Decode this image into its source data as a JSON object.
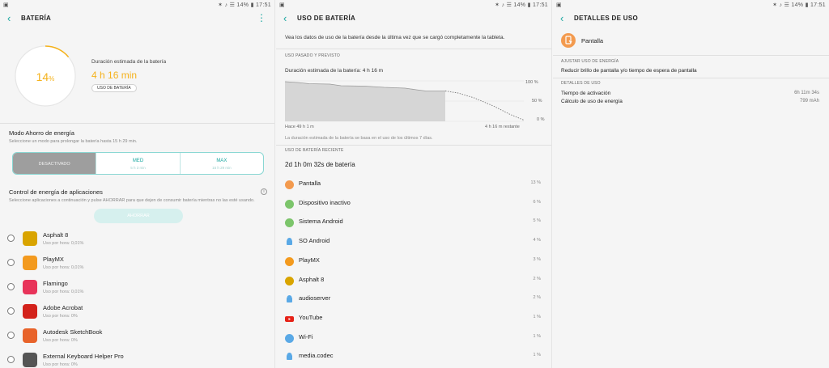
{
  "status": {
    "left_icon": "image-icon",
    "right_text": "✶ ♪ ☰ 14% ▮ 17:51"
  },
  "panel1": {
    "title": "BATERÍA",
    "battery_pct": "14",
    "battery_unit": "%",
    "battery_fraction": 0.14,
    "est_label": "Duración estimada de la batería",
    "est_time": "4 h 16 min",
    "uso_button": "USO DE BATERÍA",
    "modo_title": "Modo Ahorro de energía",
    "modo_sub": "Seleccione un modo para prolongar la batería hasta 15 h 29 min.",
    "modes": [
      {
        "label": "DESACTIVADO",
        "sub": ""
      },
      {
        "label": "MED",
        "sub": "5 h 3 min"
      },
      {
        "label": "MAX",
        "sub": "15 h 29 min"
      }
    ],
    "ctrl_title": "Control de energía de aplicaciones",
    "ctrl_sub": "Seleccione aplicaciones a continuación y pulse AHORRAR para que dejen de consumir batería mientras no las esté usando.",
    "ahorrar": "AHORRAR",
    "apps": [
      {
        "name": "Asphalt 8",
        "usage": "Uso por hora: 0,01%",
        "icon": "asphalt-icon",
        "color": "#d9a400"
      },
      {
        "name": "PlayMX",
        "usage": "Uso por hora: 0,01%",
        "icon": "playmx-icon",
        "color": "#f39a1e"
      },
      {
        "name": "Flamingo",
        "usage": "Uso por hora: 0,01%",
        "icon": "flamingo-icon",
        "color": "#e8345a"
      },
      {
        "name": "Adobe Acrobat",
        "usage": "Uso por hora: 0%",
        "icon": "acrobat-icon",
        "color": "#d3221b"
      },
      {
        "name": "Autodesk SketchBook",
        "usage": "Uso por hora: 0%",
        "icon": "sketchbook-icon",
        "color": "#e8632a"
      },
      {
        "name": "External Keyboard Helper Pro",
        "usage": "Uso por hora: 0%",
        "icon": "keyboard-icon",
        "color": "#555555"
      }
    ]
  },
  "panel2": {
    "title": "USO DE BATERÍA",
    "intro": "Vea los datos de uso de la batería desde la última vez que se cargó completamente la tableta.",
    "section_past": "USO PASADO Y PREVISTO",
    "duration": "Duración estimada de la batería: 4 h 16 m",
    "chart_left": "Hace 49 h 1 m",
    "chart_right": "4 h 16 m restante",
    "y_labels": [
      "100 %",
      "50 %",
      "0 %"
    ],
    "note": "La duración estimada de la batería se basa en el uso de los últimos 7 días.",
    "section_recent": "USO DE BATERÍA RECIENTE",
    "total": "2d 1h 0m 32s de batería",
    "usage": [
      {
        "name": "Pantalla",
        "pct": "13 %",
        "icon": "screen-icon",
        "color": "#f39a4e"
      },
      {
        "name": "Dispositivo inactivo",
        "pct": "6 %",
        "icon": "idle-icon",
        "color": "#7cc56b"
      },
      {
        "name": "Sistema Android",
        "pct": "5 %",
        "icon": "android-system-icon",
        "color": "#7cc56b"
      },
      {
        "name": "SO Android",
        "pct": "4 %",
        "icon": "android-icon",
        "color": "#5aa9e6"
      },
      {
        "name": "PlayMX",
        "pct": "3 %",
        "icon": "playmx-icon",
        "color": "#f39a1e"
      },
      {
        "name": "Asphalt 8",
        "pct": "2 %",
        "icon": "asphalt-icon",
        "color": "#d9a400"
      },
      {
        "name": "audioserver",
        "pct": "2 %",
        "icon": "android-icon",
        "color": "#5aa9e6"
      },
      {
        "name": "YouTube",
        "pct": "1 %",
        "icon": "youtube-icon",
        "color": "#e62117"
      },
      {
        "name": "Wi-Fi",
        "pct": "1 %",
        "icon": "wifi-icon",
        "color": "#5aa9e6"
      },
      {
        "name": "media.codec",
        "pct": "1 %",
        "icon": "android-icon",
        "color": "#5aa9e6"
      }
    ],
    "chart_points": [
      [
        0,
        98
      ],
      [
        8,
        96
      ],
      [
        15,
        93
      ],
      [
        28,
        92
      ],
      [
        35,
        88
      ],
      [
        50,
        87
      ],
      [
        62,
        84
      ],
      [
        75,
        82
      ],
      [
        82,
        78
      ],
      [
        88,
        75
      ],
      [
        100,
        75
      ]
    ],
    "chart_forecast": [
      [
        100,
        75
      ],
      [
        108,
        70
      ],
      [
        118,
        58
      ],
      [
        130,
        38
      ],
      [
        140,
        18
      ],
      [
        149,
        3
      ]
    ]
  },
  "panel3": {
    "title": "DETALLES DE USO",
    "item": "Pantalla",
    "section_adjust": "AJUSTAR USO DE ENERGÍA",
    "bright": "Reducir brillo de pantalla y/o tiempo de espera de pantalla",
    "section_details": "DETALLES DE USO",
    "rows": [
      {
        "label": "Tiempo de activación",
        "value": "6h 11m 34s"
      },
      {
        "label": "Cálculo de uso de energía",
        "value": "799 mAh"
      }
    ]
  },
  "colors": {
    "accent": "#1aa7a0",
    "battery": "#f5b21b"
  }
}
